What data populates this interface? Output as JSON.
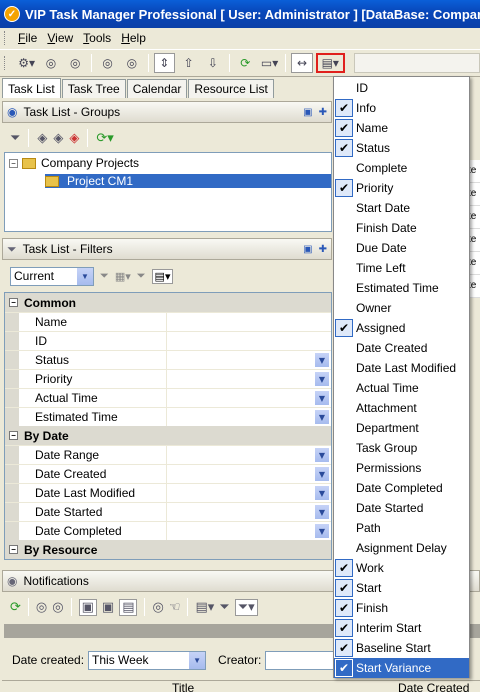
{
  "window": {
    "title": "VIP Task Manager Professional [ User: Administrator ] [DataBase: Company"
  },
  "menu": [
    "File",
    "View",
    "Tools",
    "Help"
  ],
  "tabs": [
    "Task List",
    "Task Tree",
    "Calendar",
    "Resource List"
  ],
  "groups_pane": {
    "title": "Task List - Groups"
  },
  "tree": {
    "root": "Company Projects",
    "child": "Project CM1"
  },
  "filters_pane": {
    "title": "Task List - Filters",
    "current_filter": "Current"
  },
  "property_grid": {
    "categories": [
      {
        "name": "Common",
        "rows": [
          "Name",
          "ID",
          "Status",
          "Priority",
          "Actual Time",
          "Estimated Time"
        ]
      },
      {
        "name": "By Date",
        "rows": [
          "Date Range",
          "Date Created",
          "Date Last Modified",
          "Date Started",
          "Date Completed"
        ]
      },
      {
        "name": "By Resource",
        "rows": []
      }
    ]
  },
  "notifications": {
    "title": "Notifications",
    "date_created_label": "Date created:",
    "date_created_value": "This Week",
    "creator_label": "Creator:",
    "col_title": "Title",
    "col_date_created": "Date Created"
  },
  "right_column_cells": [
    "te",
    "te",
    "te",
    "te",
    "te",
    "te"
  ],
  "column_menu": {
    "items": [
      {
        "label": "ID",
        "checked": false
      },
      {
        "label": "Info",
        "checked": true
      },
      {
        "label": "Name",
        "checked": true
      },
      {
        "label": "Status",
        "checked": true
      },
      {
        "label": "Complete",
        "checked": false
      },
      {
        "label": "Priority",
        "checked": true
      },
      {
        "label": "Start Date",
        "checked": false
      },
      {
        "label": "Finish Date",
        "checked": false
      },
      {
        "label": "Due Date",
        "checked": false
      },
      {
        "label": "Time Left",
        "checked": false
      },
      {
        "label": "Estimated Time",
        "checked": false
      },
      {
        "label": "Owner",
        "checked": false
      },
      {
        "label": "Assigned",
        "checked": true
      },
      {
        "label": "Date Created",
        "checked": false
      },
      {
        "label": "Date Last Modified",
        "checked": false
      },
      {
        "label": "Actual Time",
        "checked": false
      },
      {
        "label": "Attachment",
        "checked": false
      },
      {
        "label": "Department",
        "checked": false
      },
      {
        "label": "Task Group",
        "checked": false
      },
      {
        "label": "Permissions",
        "checked": false
      },
      {
        "label": "Date Completed",
        "checked": false
      },
      {
        "label": "Date Started",
        "checked": false
      },
      {
        "label": "Path",
        "checked": false
      },
      {
        "label": "Asignment Delay",
        "checked": false
      },
      {
        "label": "Work",
        "checked": true
      },
      {
        "label": "Start",
        "checked": true
      },
      {
        "label": "Finish",
        "checked": true
      },
      {
        "label": "Interim Start",
        "checked": true
      },
      {
        "label": "Baseline Start",
        "checked": true
      },
      {
        "label": "Start Variance",
        "checked": true,
        "highlighted": true
      }
    ]
  },
  "colors": {
    "title_bar": "#0a46b8",
    "selection": "#316ac5",
    "highlight_border": "#e0201c"
  }
}
